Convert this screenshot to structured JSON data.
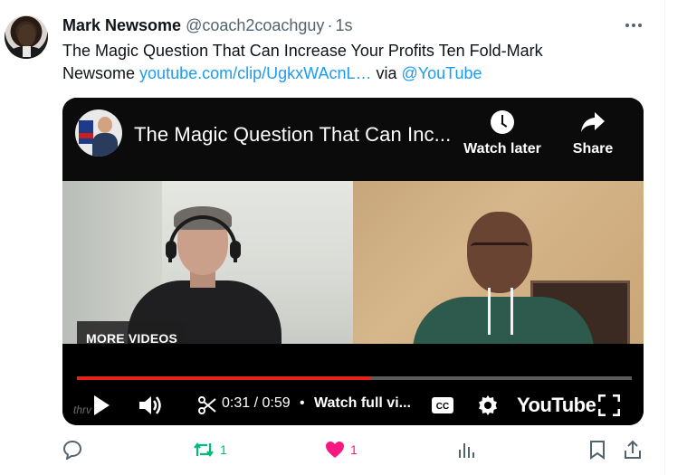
{
  "tweet": {
    "author_name": "Mark Newsome",
    "author_handle": "@coach2coachguy",
    "separator": "·",
    "time": "1s",
    "text_before": "The Magic Question That Can Increase Your Profits Ten Fold-Mark Newsome",
    "link_text": "youtube.com/clip/UgkxWAcnL…",
    "via_text": "via",
    "mention": "@YouTube"
  },
  "video": {
    "title": "The Magic Question That Can Inc...",
    "watch_later_label": "Watch later",
    "share_label": "Share",
    "more_videos_label": "MORE VIDEOS",
    "current_time": "0:31 / 0:59",
    "bullet": "•",
    "watch_full_label": "Watch full vi...",
    "youtube_logo": "YouTube",
    "watermark": "thrv",
    "progress_fraction": 0.53
  },
  "actions": {
    "retweet_count": "1",
    "like_count": "1"
  },
  "colors": {
    "link": "#1d9bf0",
    "retweet": "#00ba7c",
    "like": "#f91880",
    "progress": "#e62117",
    "muted": "#536471"
  },
  "icons": [
    "more-icon",
    "clock-icon",
    "share-arrow-icon",
    "play-icon",
    "volume-icon",
    "scissors-icon",
    "cc-icon",
    "settings-gear-icon",
    "fullscreen-icon",
    "reply-icon",
    "retweet-icon",
    "heart-icon",
    "analytics-icon",
    "bookmark-icon",
    "upload-icon"
  ]
}
